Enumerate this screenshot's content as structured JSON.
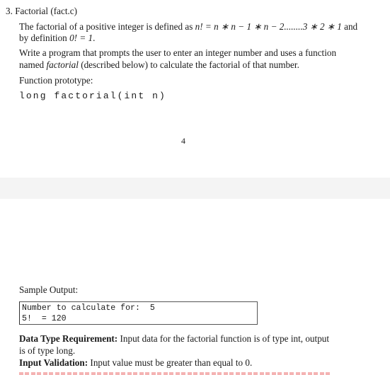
{
  "page1": {
    "heading": "3. Factorial (fact.c)",
    "para1": {
      "line1_prefix": "The factorial of a positive integer is defined as ",
      "line1_math": "n! = n ∗ n − 1 ∗ n − 2........3 ∗ 2 ∗ 1",
      "line1_suffix": " and",
      "line2_prefix": "by definition ",
      "line2_math": "0! = 1",
      "line2_suffix": "."
    },
    "para2": {
      "line1": "Write a program that prompts the user to enter an integer number and uses a function",
      "line2_prefix": "named ",
      "line2_emph": "factorial",
      "line2_suffix": " (described below) to calculate the factorial of that number."
    },
    "prototype_label": "Function prototype:",
    "prototype_code": "long factorial(int n)",
    "page_number": "4"
  },
  "page2": {
    "sample_label": "Sample Output:",
    "sample_output": [
      "Number to calculate for:  5",
      "5!  = 120"
    ],
    "data_type": {
      "label": "Data Type Requirement:",
      "line1": " Input data for the factorial function is of type int, output",
      "line2": "is of type long."
    },
    "input_validation": {
      "label": "Input Validation:",
      "text": " Input value must be greater than equal to 0."
    },
    "highlight_color": "#f2a0a0"
  }
}
